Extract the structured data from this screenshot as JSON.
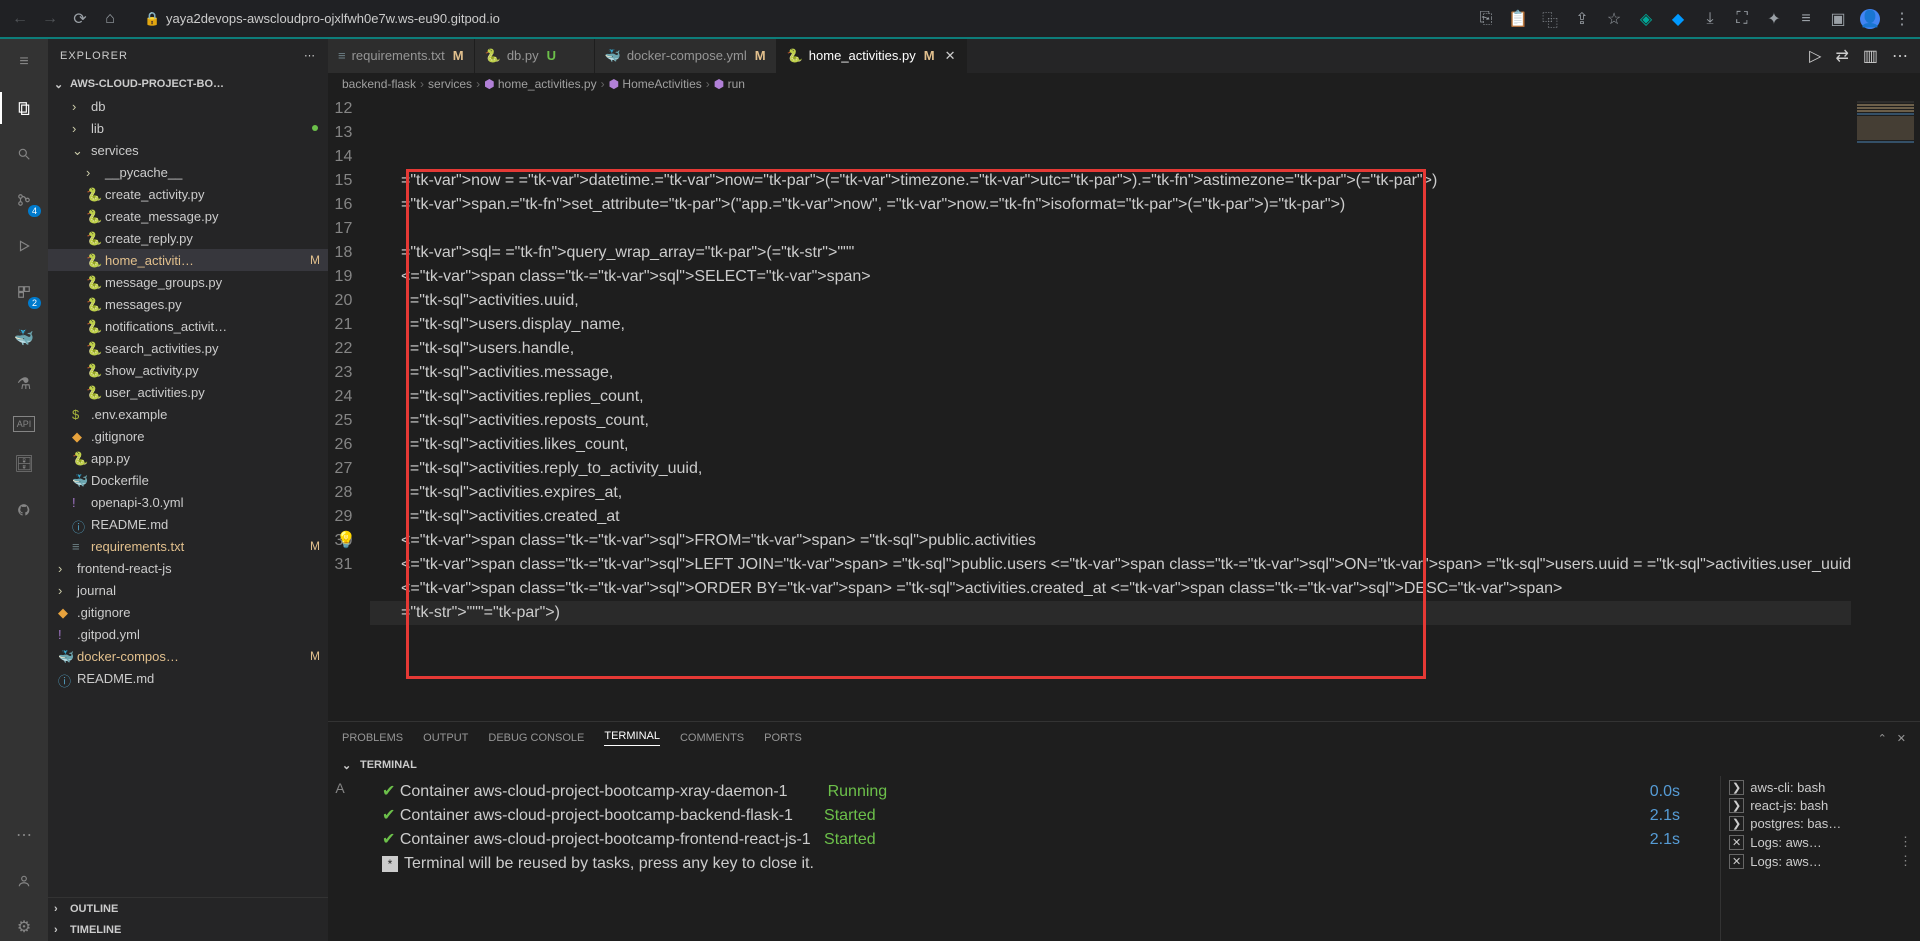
{
  "browser": {
    "url": "yaya2devops-awscloudpro-ojxlfwh0e7w.ws-eu90.gitpod.io"
  },
  "sidebar": {
    "title": "EXPLORER",
    "project": "AWS-CLOUD-PROJECT-BO…",
    "outline": "OUTLINE",
    "timeline": "TIMELINE",
    "tree": [
      {
        "name": "db",
        "type": "folder",
        "indent": 1,
        "mod": ""
      },
      {
        "name": "lib",
        "type": "folder",
        "indent": 1,
        "mod": "",
        "untracked": true
      },
      {
        "name": "services",
        "type": "folder",
        "indent": 1,
        "mod": "",
        "open": true
      },
      {
        "name": "__pycache__",
        "type": "folder",
        "indent": 2,
        "mod": ""
      },
      {
        "name": "create_activity.py",
        "type": "py",
        "indent": 2,
        "mod": ""
      },
      {
        "name": "create_message.py",
        "type": "py",
        "indent": 2,
        "mod": ""
      },
      {
        "name": "create_reply.py",
        "type": "py",
        "indent": 2,
        "mod": ""
      },
      {
        "name": "home_activiti…",
        "type": "py",
        "indent": 2,
        "mod": "M",
        "selected": true
      },
      {
        "name": "message_groups.py",
        "type": "py",
        "indent": 2,
        "mod": ""
      },
      {
        "name": "messages.py",
        "type": "py",
        "indent": 2,
        "mod": ""
      },
      {
        "name": "notifications_activit…",
        "type": "py",
        "indent": 2,
        "mod": ""
      },
      {
        "name": "search_activities.py",
        "type": "py",
        "indent": 2,
        "mod": ""
      },
      {
        "name": "show_activity.py",
        "type": "py",
        "indent": 2,
        "mod": ""
      },
      {
        "name": "user_activities.py",
        "type": "py",
        "indent": 2,
        "mod": ""
      },
      {
        "name": ".env.example",
        "type": "env",
        "indent": 1,
        "mod": ""
      },
      {
        "name": ".gitignore",
        "type": "git",
        "indent": 1,
        "mod": ""
      },
      {
        "name": "app.py",
        "type": "py",
        "indent": 1,
        "mod": ""
      },
      {
        "name": "Dockerfile",
        "type": "docker",
        "indent": 1,
        "mod": ""
      },
      {
        "name": "openapi-3.0.yml",
        "type": "yml",
        "indent": 1,
        "mod": ""
      },
      {
        "name": "README.md",
        "type": "md",
        "indent": 1,
        "mod": ""
      },
      {
        "name": "requirements.txt",
        "type": "txt",
        "indent": 1,
        "mod": "M"
      },
      {
        "name": "frontend-react-js",
        "type": "folder",
        "indent": 0,
        "mod": ""
      },
      {
        "name": "journal",
        "type": "folder",
        "indent": 0,
        "mod": ""
      },
      {
        "name": ".gitignore",
        "type": "git",
        "indent": 0,
        "mod": ""
      },
      {
        "name": ".gitpod.yml",
        "type": "yml",
        "indent": 0,
        "mod": ""
      },
      {
        "name": "docker-compos…",
        "type": "docker-compose",
        "indent": 0,
        "mod": "M"
      },
      {
        "name": "README.md",
        "type": "md",
        "indent": 0,
        "mod": ""
      }
    ]
  },
  "tabs": [
    {
      "label": "requirements.txt",
      "icon": "txt",
      "mod": "M",
      "active": false
    },
    {
      "label": "db.py",
      "icon": "py",
      "mod": "U",
      "modclass": "green",
      "active": false
    },
    {
      "label": "docker-compose.yml",
      "icon": "docker",
      "mod": "M",
      "active": false
    },
    {
      "label": "home_activities.py",
      "icon": "py",
      "mod": "M",
      "active": true,
      "close": true
    }
  ],
  "breadcrumbs": [
    "backend-flask",
    "services",
    "home_activities.py",
    "HomeActivities",
    "run"
  ],
  "code": {
    "start": 12,
    "lines": [
      "      now = datetime.now(timezone.utc).astimezone()",
      "      span.set_attribute(\"app.now\", now.isoformat())",
      "",
      "      sql= query_wrap_array(\"\"\"",
      "      SELECT",
      "        activities.uuid,",
      "        users.display_name,",
      "        users.handle,",
      "        activities.message,",
      "        activities.replies_count,",
      "        activities.reposts_count,",
      "        activities.likes_count,",
      "        activities.reply_to_activity_uuid,",
      "        activities.expires_at,",
      "        activities.created_at",
      "      FROM public.activities",
      "      LEFT JOIN public.users ON users.uuid = activities.user_uuid",
      "      ORDER BY activities.created_at DESC",
      "      \"\"\")",
      ""
    ]
  },
  "panel": {
    "tabs": [
      "PROBLEMS",
      "OUTPUT",
      "DEBUG CONSOLE",
      "TERMINAL",
      "COMMENTS",
      "PORTS"
    ],
    "head": "TERMINAL",
    "lines": [
      {
        "check": true,
        "text": "Container aws-cloud-project-bootcamp-xray-daemon-1",
        "status": "Running",
        "time": "0.0s"
      },
      {
        "check": true,
        "text": "Container aws-cloud-project-bootcamp-backend-flask-1",
        "status": "Started",
        "time": "2.1s"
      },
      {
        "check": true,
        "text": "Container aws-cloud-project-bootcamp-frontend-react-js-1",
        "status": "Started",
        "time": "2.1s"
      },
      {
        "star": true,
        "text": "Terminal will be reused by tasks, press any key to close it."
      }
    ],
    "side": [
      "aws-cli: bash",
      "react-js: bash",
      "postgres: bas…",
      "Logs: aws…",
      "Logs: aws…"
    ]
  }
}
